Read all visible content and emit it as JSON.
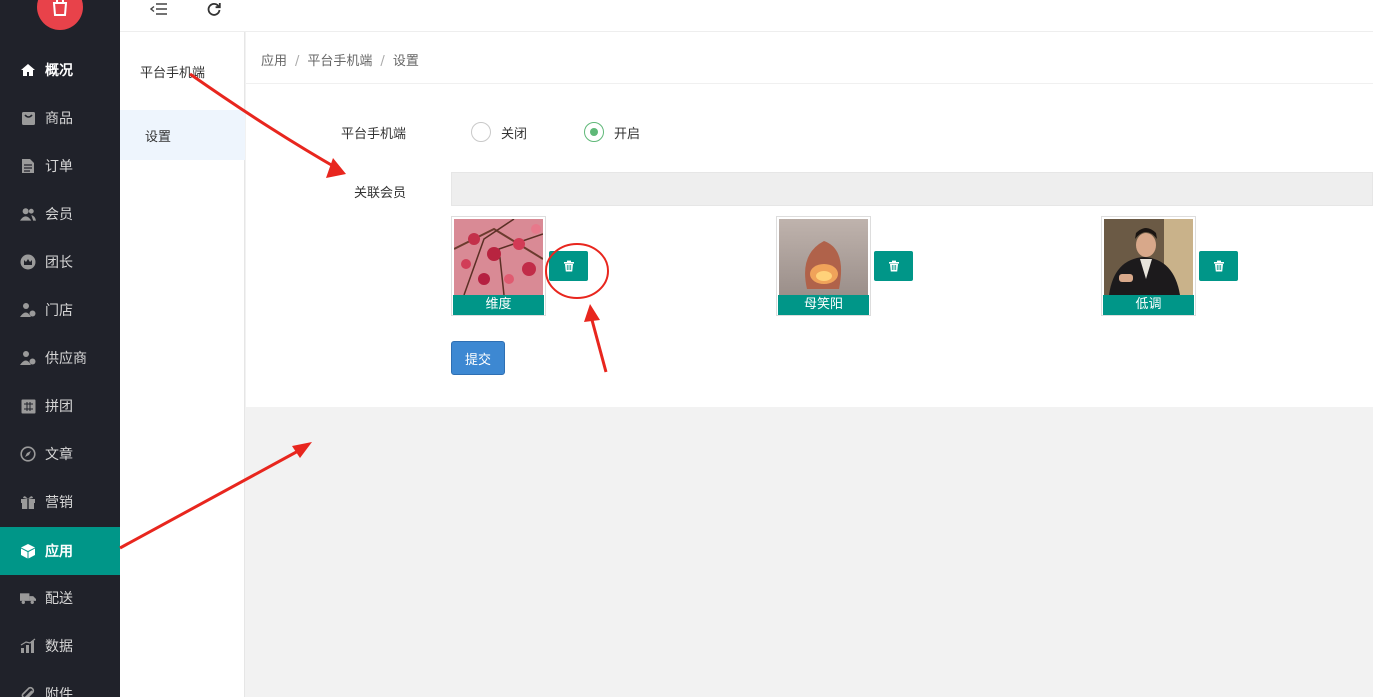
{
  "nav": {
    "items": [
      {
        "label": "概况",
        "icon": "home-icon"
      },
      {
        "label": "商品",
        "icon": "goods-icon"
      },
      {
        "label": "订单",
        "icon": "order-icon"
      },
      {
        "label": "会员",
        "icon": "users-icon"
      },
      {
        "label": "团长",
        "icon": "crown-icon"
      },
      {
        "label": "门店",
        "icon": "store-icon"
      },
      {
        "label": "供应商",
        "icon": "supplier-icon"
      },
      {
        "label": "拼团",
        "icon": "group-icon"
      },
      {
        "label": "文章",
        "icon": "compass-icon"
      },
      {
        "label": "营销",
        "icon": "gift-icon"
      },
      {
        "label": "应用",
        "icon": "cube-icon"
      },
      {
        "label": "配送",
        "icon": "truck-icon"
      },
      {
        "label": "数据",
        "icon": "chart-icon"
      },
      {
        "label": "附件",
        "icon": "paperclip-icon"
      }
    ],
    "active_index": 10,
    "active_color": "#009688"
  },
  "submenu": {
    "title": "平台手机端",
    "items": [
      {
        "label": "设置"
      }
    ]
  },
  "breadcrumb": [
    "应用",
    "平台手机端",
    "设置"
  ],
  "breadcrumb_sep": "/",
  "form": {
    "platform_label": "平台手机端",
    "radio_off": "关闭",
    "radio_on": "开启",
    "selected": "开启",
    "member_label": "关联会员",
    "members": [
      {
        "name": "维度"
      },
      {
        "name": "母笑阳"
      },
      {
        "name": "低调"
      }
    ],
    "submit_label": "提交"
  },
  "colors": {
    "accent": "#009688",
    "radio_checked": "#5fb878",
    "submit": "#3d88d2",
    "annotation": "#e8261e"
  }
}
